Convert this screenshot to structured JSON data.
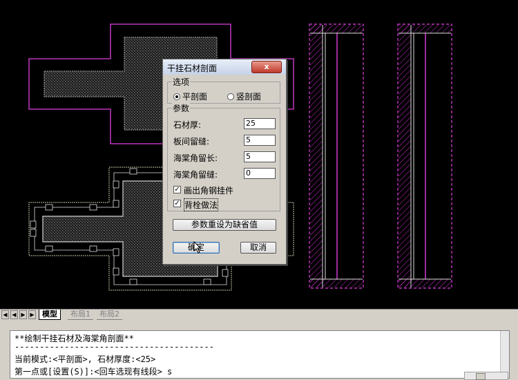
{
  "dialog": {
    "title": "干挂石材剖面",
    "close_label": "x",
    "options_group": "选项",
    "radio_plan": "平剖面",
    "radio_elev": "竖剖面",
    "params_group": "参数",
    "stone_thickness_label": "石材厚:",
    "stone_thickness_value": "25",
    "gap_label": "板间留缝:",
    "gap_value": "5",
    "corner_length_label": "海棠角留长:",
    "corner_length_value": "5",
    "corner_gap_label": "海棠角留缝:",
    "corner_gap_value": "0",
    "check_draw_steel_label": "画出角钢挂件",
    "check_back_label": "背栓做法",
    "reset_button": "参数重设为缺省值",
    "ok_button": "确定",
    "cancel_button": "取消"
  },
  "tabs": {
    "model": "模型",
    "layout1": "布局1",
    "layout2": "布局2"
  },
  "command": {
    "line1": "**绘制干挂石材及海棠角剖面**",
    "line2": "----------------------------------------",
    "line3": "当前模式:<平剖面>, 石材厚度:<25>",
    "line4": "第一点或[设置(S)]:<回车选现有线段> s"
  },
  "colors": {
    "accent_magenta": "#e040e0",
    "canvas_bg": "#000000"
  }
}
